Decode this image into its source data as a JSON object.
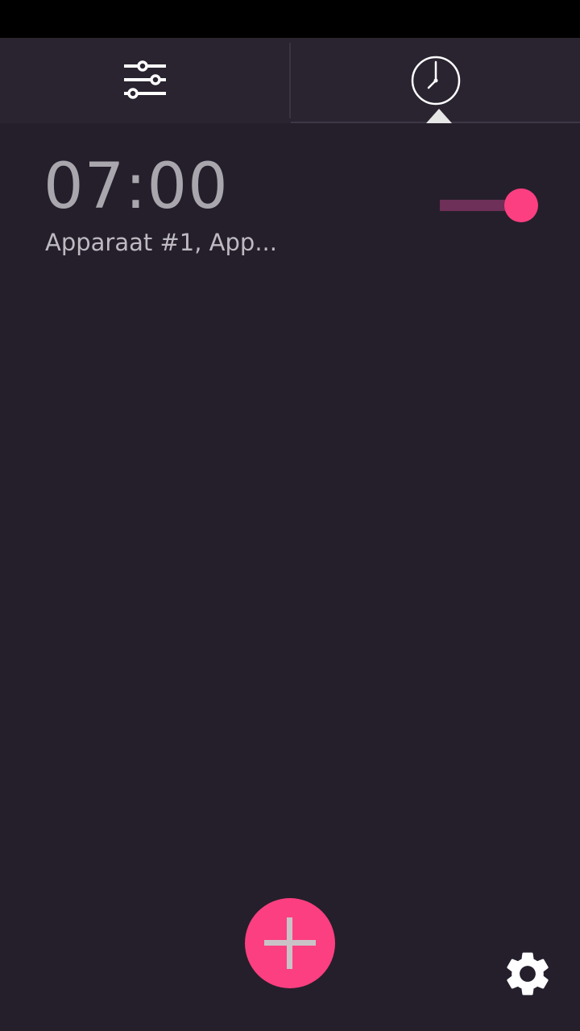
{
  "tabs": [
    {
      "icon": "sliders-icon",
      "active": false
    },
    {
      "icon": "clock-icon",
      "active": true
    }
  ],
  "alarms": [
    {
      "time": "07:00",
      "label": "Apparaat #1, App...",
      "enabled": true
    }
  ],
  "fab": {
    "icon": "plus-icon"
  },
  "footer": {
    "icon": "gear-icon"
  },
  "colors": {
    "accent": "#fc3f80",
    "background": "#251f2c",
    "tab_bar": "#2a2431",
    "toggle_track": "#6e2f58"
  }
}
